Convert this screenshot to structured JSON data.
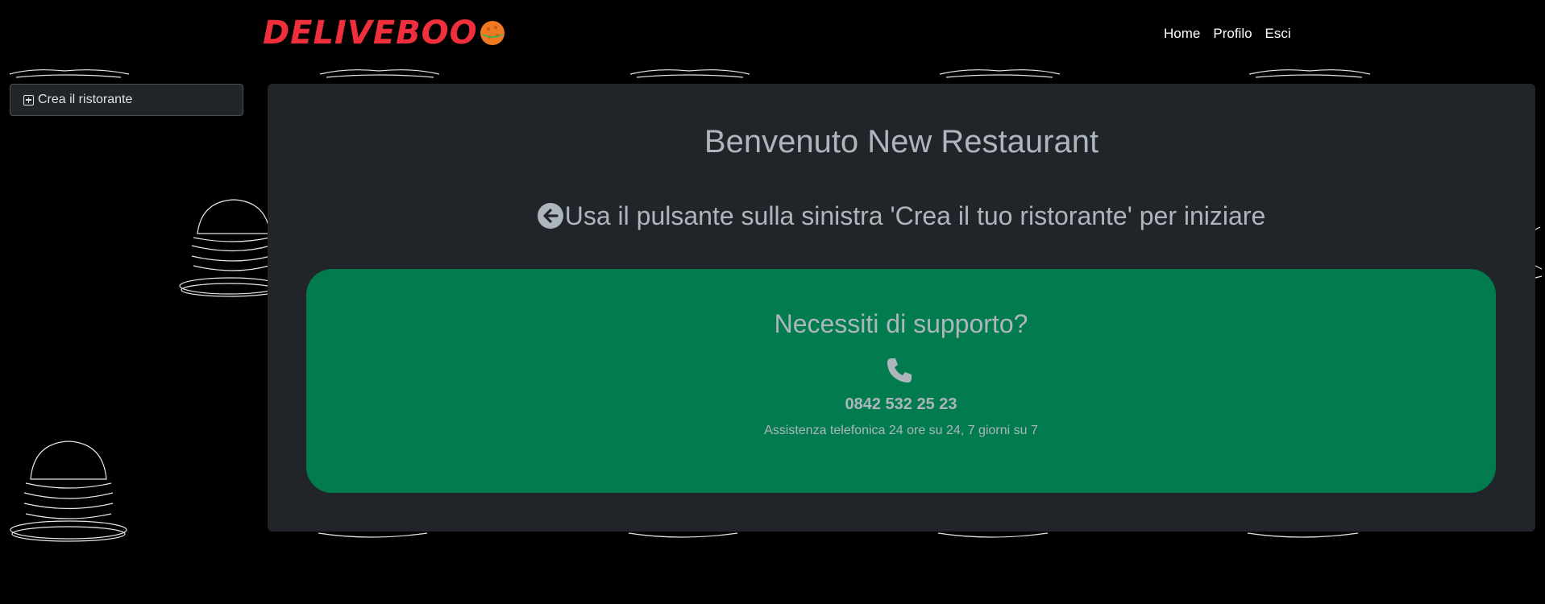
{
  "header": {
    "logo_text": "DELIVEBOO",
    "nav": [
      {
        "label": "Home"
      },
      {
        "label": "Profilo"
      },
      {
        "label": "Esci"
      }
    ]
  },
  "sidebar": {
    "create_restaurant_label": "Crea il ristorante",
    "create_icon": "plus-square-icon"
  },
  "main": {
    "welcome_title": "Benvenuto New Restaurant",
    "instruction_text": "Usa il pulsante sulla sinistra 'Crea il tuo ristorante' per iniziare",
    "instruction_icon": "arrow-left-circle-icon"
  },
  "support": {
    "title": "Necessiti di supporto?",
    "icon": "phone-icon",
    "phone_number": "0842 532 25 23",
    "note": "Assistenza telefonica 24 ore su 24, 7 giorni su 7"
  },
  "colors": {
    "page_background": "#000000",
    "panel_background": "#212529",
    "support_background": "#027c4f",
    "muted_text": "#adb5bd",
    "logo_red": "#ef2f3c",
    "logo_orange": "#f07a22"
  }
}
